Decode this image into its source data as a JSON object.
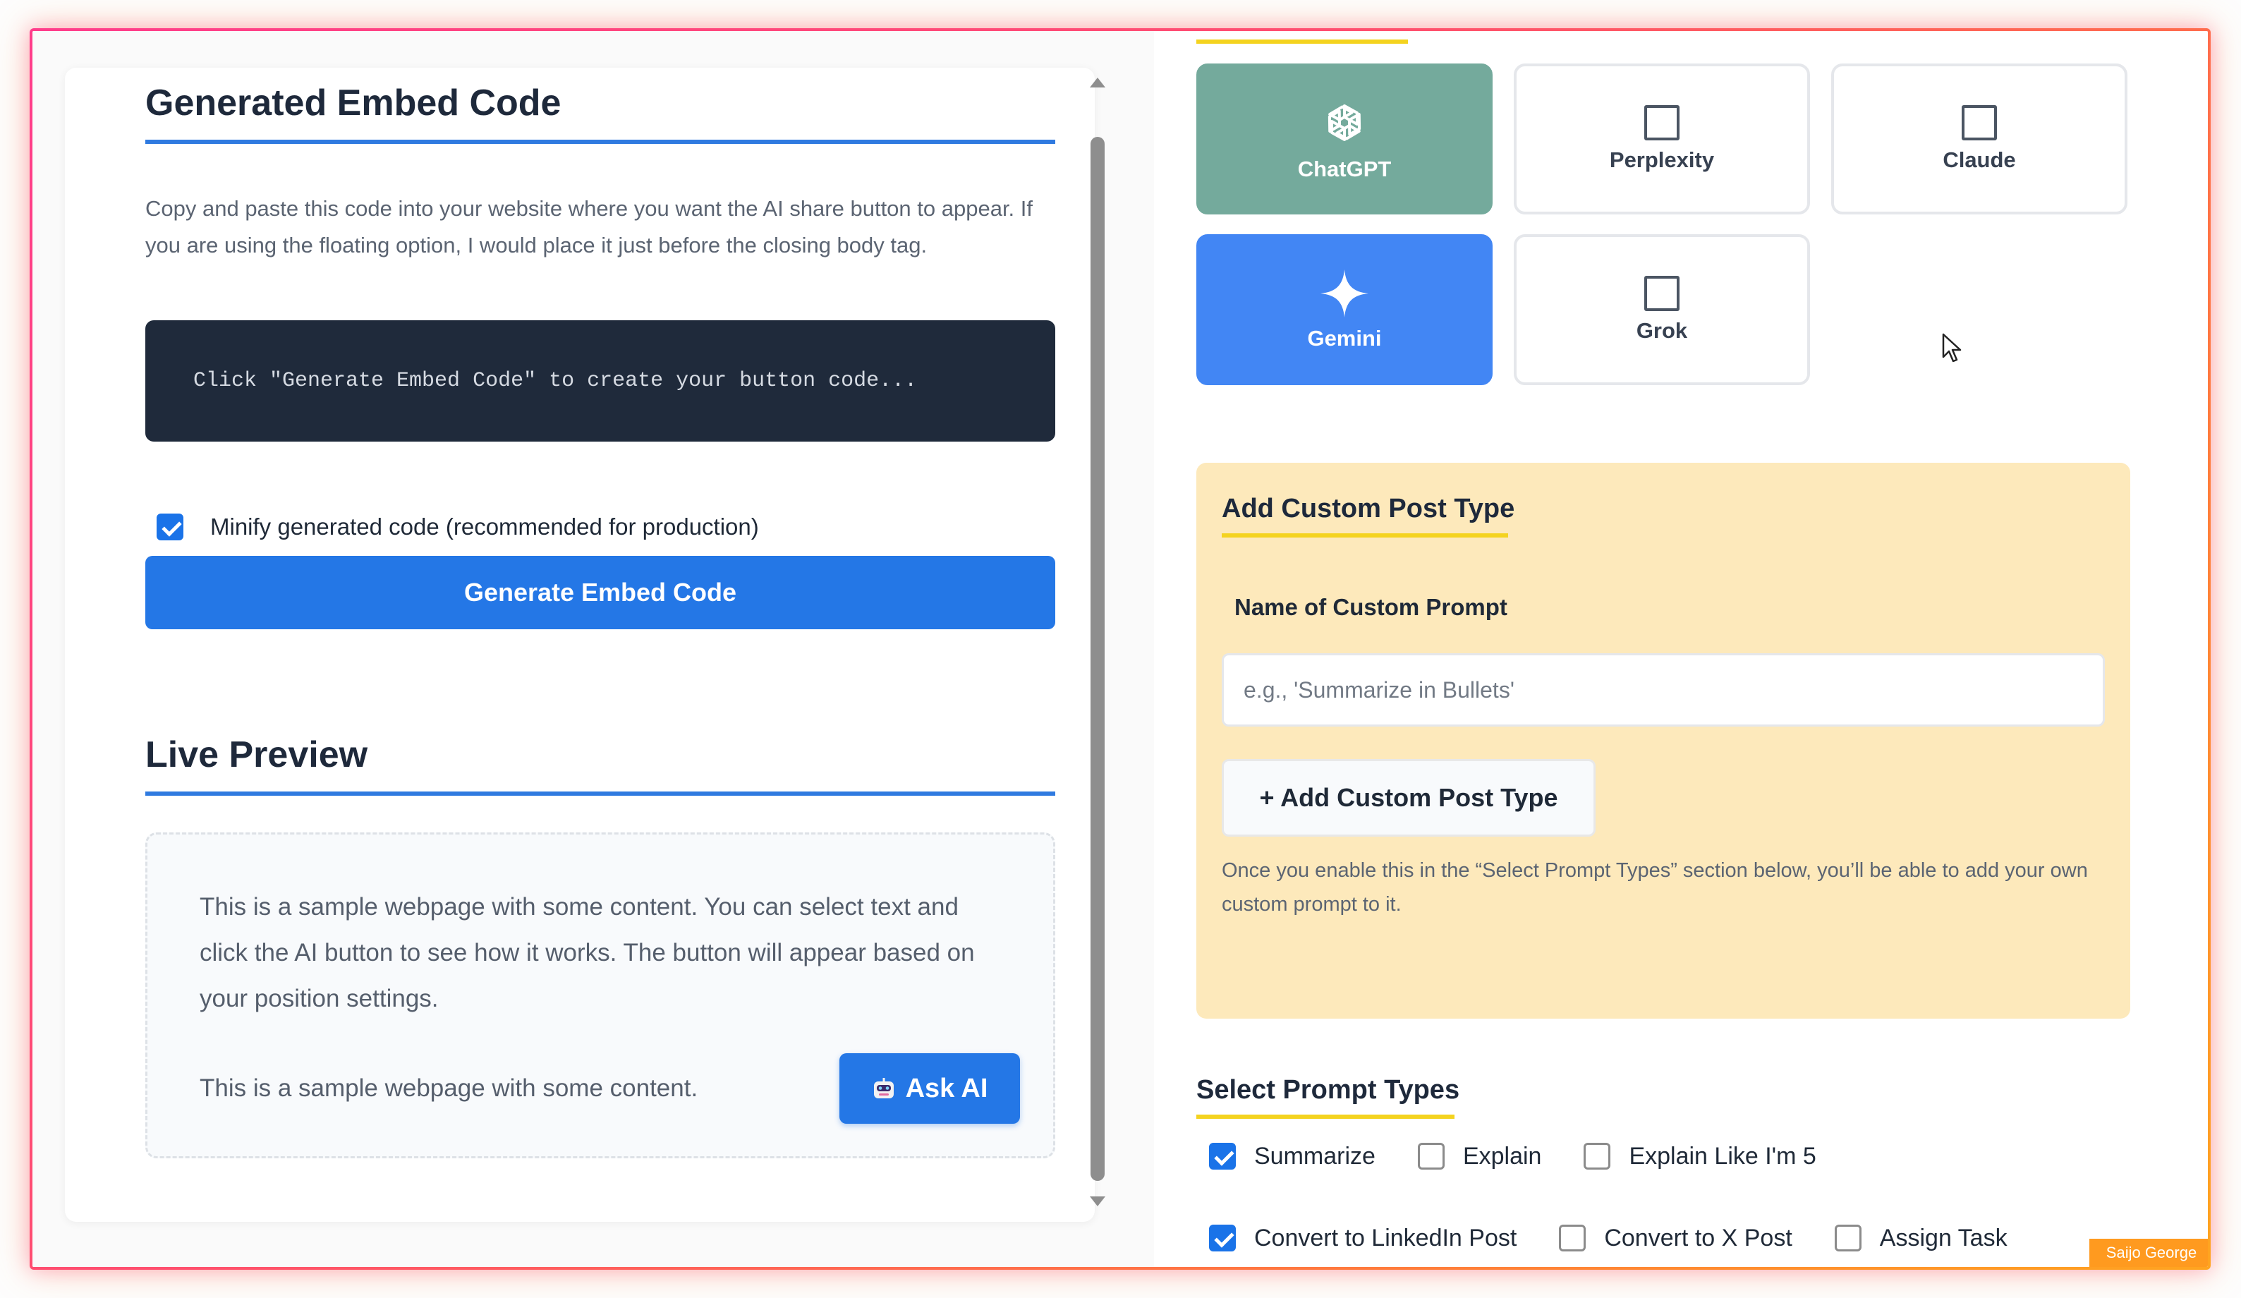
{
  "left": {
    "embed_title": "Generated Embed Code",
    "embed_desc": "Copy and paste this code into your website where you want the AI share button to appear. If you are using the floating option, I would place it just before the closing body tag.",
    "code_placeholder": "Click \"Generate Embed Code\" to create your button code...",
    "minify_label": "Minify generated code (recommended for production)",
    "minify_checked": true,
    "generate_button": "Generate Embed Code",
    "preview_title": "Live Preview",
    "preview_paragraph": "This is a sample webpage with some content. You can select text and click the AI button to see how it works. The button will appear based on your position settings.",
    "preview_line": "This is a sample webpage with some content.",
    "ask_ai_button": "Ask AI"
  },
  "right": {
    "llm_options": [
      {
        "label": "ChatGPT",
        "selected": true,
        "icon": "openai-icon"
      },
      {
        "label": "Perplexity",
        "selected": false,
        "icon": "checkbox-square-icon"
      },
      {
        "label": "Claude",
        "selected": false,
        "icon": "checkbox-square-icon"
      },
      {
        "label": "Gemini",
        "selected": true,
        "icon": "sparkle-icon"
      },
      {
        "label": "Grok",
        "selected": false,
        "icon": "checkbox-square-icon"
      }
    ],
    "custom_title": "Add Custom Post Type",
    "name_label": "Name of Custom Prompt",
    "name_placeholder": "e.g., 'Summarize in Bullets'",
    "add_button": "+ Add Custom Post Type",
    "custom_help": "Once you enable this in the “Select Prompt Types” section below, you’ll be able to add your own custom prompt to it.",
    "prompt_title": "Select Prompt Types",
    "prompt_types": [
      [
        {
          "label": "Summarize",
          "checked": true
        },
        {
          "label": "Explain",
          "checked": false
        },
        {
          "label": "Explain Like I'm 5",
          "checked": false
        }
      ],
      [
        {
          "label": "Convert to LinkedIn Post",
          "checked": true
        },
        {
          "label": "Convert to X Post",
          "checked": false
        },
        {
          "label": "Assign Task",
          "checked": false
        }
      ]
    ]
  },
  "watermark": "Saijo George",
  "colors": {
    "accent": "#2477e6",
    "chatgpt": "#74aa9c",
    "gemini": "#4286f4",
    "custom_bg": "#fde9bb",
    "highlight": "#f4d31f"
  }
}
